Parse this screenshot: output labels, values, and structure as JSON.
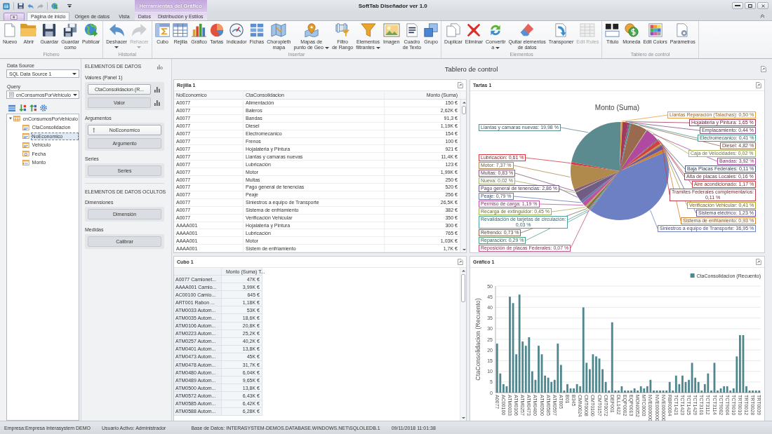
{
  "window": {
    "title": "SoftTab Diseñador ver 1.0",
    "context_header": "Herramientas del Gráfico"
  },
  "ribbon": {
    "tabs": [
      {
        "label": "Página de inicio",
        "selected": true,
        "contextual": false
      },
      {
        "label": "Origen de datos",
        "selected": false,
        "contextual": false
      },
      {
        "label": "Vista",
        "selected": false,
        "contextual": false
      },
      {
        "label": "Datos",
        "selected": false,
        "contextual": true
      },
      {
        "label": "Distribución y Estilos",
        "selected": false,
        "contextual": true
      }
    ],
    "groups": [
      {
        "label": "Fichero",
        "buttons": [
          {
            "label": "Nuevo",
            "disabled": false,
            "menu": false
          },
          {
            "label": "Abrir",
            "disabled": false,
            "menu": false
          },
          {
            "label": "Guardar",
            "disabled": false,
            "menu": false
          },
          {
            "label": "Guardar\ncomo",
            "disabled": false,
            "menu": false
          },
          {
            "label": "Publicar",
            "disabled": false,
            "menu": false
          }
        ]
      },
      {
        "label": "Historial",
        "buttons": [
          {
            "label": "Deshacer",
            "disabled": false,
            "menu": true
          },
          {
            "label": "Rehacer",
            "disabled": true,
            "menu": true
          }
        ]
      },
      {
        "label": "Insertar",
        "buttons": [
          {
            "label": "Cubo",
            "disabled": false,
            "menu": false
          },
          {
            "label": "Rejilla",
            "disabled": false,
            "menu": false
          },
          {
            "label": "Gráfico",
            "disabled": false,
            "menu": false
          },
          {
            "label": "Tartas",
            "disabled": false,
            "menu": false
          },
          {
            "label": "Indicador",
            "disabled": false,
            "menu": false
          },
          {
            "label": "Fichas",
            "disabled": false,
            "menu": false
          },
          {
            "label": "Choropleth\nmapa",
            "disabled": false,
            "menu": false
          },
          {
            "label": "Mapas de\npunto de Geo",
            "disabled": false,
            "menu": true
          },
          {
            "label": "Filtro\nde Rango",
            "disabled": false,
            "menu": false
          },
          {
            "label": "Elementos\nfiltrantes",
            "disabled": false,
            "menu": true
          },
          {
            "label": "Imagen",
            "disabled": false,
            "menu": false
          },
          {
            "label": "Cuadro\nde Texto",
            "disabled": false,
            "menu": false
          },
          {
            "label": "Grupo",
            "disabled": false,
            "menu": false
          }
        ]
      },
      {
        "label": "Elementos",
        "buttons": [
          {
            "label": "Duplicar",
            "disabled": false,
            "menu": false
          },
          {
            "label": "Eliminar",
            "disabled": false,
            "menu": false
          },
          {
            "label": "Convertir\na",
            "disabled": false,
            "menu": true
          },
          {
            "label": "Quitar elementos\nde datos",
            "disabled": false,
            "menu": false
          },
          {
            "label": "Transponer",
            "disabled": false,
            "menu": false
          },
          {
            "label": "Edit Rules",
            "disabled": true,
            "menu": false
          }
        ]
      },
      {
        "label": "Tablero de control",
        "buttons": [
          {
            "label": "Título",
            "disabled": false,
            "menu": false
          },
          {
            "label": "Moneda",
            "disabled": false,
            "menu": false
          },
          {
            "label": "Edit Colors",
            "disabled": false,
            "menu": false
          },
          {
            "label": "Parámetros",
            "disabled": false,
            "menu": false
          }
        ]
      }
    ]
  },
  "data_source": {
    "label": "Data Source",
    "value": "SQL Data Source 1"
  },
  "query": {
    "label": "Query",
    "value": "cnConsumosPorVehiculo"
  },
  "field_tree": [
    {
      "label": "cnConsumosPorVehiculo",
      "expanded": true,
      "selected": false,
      "children": [
        {
          "label": "CtaConsolidacion",
          "selected": false,
          "kind": "text"
        },
        {
          "label": "NoEconomico",
          "selected": true,
          "kind": "text"
        },
        {
          "label": "Vehiculo",
          "selected": false,
          "kind": "text"
        },
        {
          "label": "Fecha",
          "selected": false,
          "kind": "date"
        },
        {
          "label": "Monto",
          "selected": false,
          "kind": "number"
        }
      ]
    }
  ],
  "data_items": {
    "title": "ELEMENTOS DE DATOS",
    "sections": [
      {
        "label": "Valores (Panel 1)",
        "slots": [
          {
            "text": "CtaConsolidacion (R...",
            "filled": true,
            "kind": "value"
          },
          {
            "text": "Valor",
            "filled": false,
            "kind": "value"
          }
        ]
      },
      {
        "label": "Argumentos",
        "slots": [
          {
            "text": "NoEconomico",
            "filled": true,
            "kind": "field"
          },
          {
            "text": "Argumento",
            "filled": false,
            "kind": "field"
          }
        ]
      },
      {
        "label": "Series",
        "slots": [
          {
            "text": "Series",
            "filled": false,
            "kind": "field"
          }
        ]
      }
    ],
    "hidden_title": "ELEMENTOS DE DATOS OCULTOS",
    "hidden_sections": [
      {
        "label": "Dimensiones",
        "slots": [
          {
            "text": "Dimensión",
            "filled": false,
            "kind": "field"
          }
        ]
      },
      {
        "label": "Medidas",
        "slots": [
          {
            "text": "Calibrar",
            "filled": false,
            "kind": "field"
          }
        ]
      }
    ]
  },
  "dashboard": {
    "title": "Tablero de control",
    "grid": {
      "title": "Rejilla 1",
      "columns": [
        "NoEconomico",
        "CtaConsolidacion",
        "Monto (Suma)"
      ],
      "rows": [
        [
          "A0077",
          "Alimentación",
          "150 €"
        ],
        [
          "A0077",
          "Baleros",
          "2,62K €"
        ],
        [
          "A0077",
          "Bandas",
          "91,3 €"
        ],
        [
          "A0077",
          "Diesel",
          "1,19K €"
        ],
        [
          "A0077",
          "Electromecanico",
          "154 €"
        ],
        [
          "A0077",
          "Frenos",
          "100 €"
        ],
        [
          "A0077",
          "Hojalateria y Pintura",
          "921 €"
        ],
        [
          "A0077",
          "Llantas y camaras nuevas",
          "11,4K €"
        ],
        [
          "A0077",
          "Lubricación",
          "123 €"
        ],
        [
          "A0077",
          "Motor",
          "1,99K €"
        ],
        [
          "A0077",
          "Multas",
          "250 €"
        ],
        [
          "A0077",
          "Pago general de tenencias",
          "520 €"
        ],
        [
          "A0077",
          "Peaje",
          "256 €"
        ],
        [
          "A0077",
          "Siniestros a equipo de Transporte",
          "26,5K €"
        ],
        [
          "A0077",
          "Sistema de enfriamiento",
          "382 €"
        ],
        [
          "A0077",
          "Verificación Vehicular",
          "350 €"
        ],
        [
          "AAAA001",
          "Hojalateria y Pintura",
          "300 €"
        ],
        [
          "AAAA001",
          "Lubricación",
          "765 €"
        ],
        [
          "AAAA001",
          "Motor",
          "1,03K €"
        ],
        [
          "AAAA001",
          "Sistem de enfriamiento",
          "1,7K €"
        ]
      ]
    },
    "pie": {
      "title": "Tartas 1",
      "chart_data": {
        "type": "pie",
        "title": "Monto (Suma)",
        "categories": [
          "Lubricación: 0,61 %",
          "Llantas y camaras nuevas: 19,98 %",
          "Llantas Reparación (Talachas): 0,50 %",
          "Hojalateria y Pintura: 1,65 %",
          "Emplacamiento: 0,44 %",
          "Electromecanico: 0,41 %",
          "Diesel: 4,82 %",
          "Caja de Velocidades: 0,02 %",
          "Bandas: 3,92 %",
          "Baja Placas Federales: 0,11 %",
          "Alta de placas Locales: 0,16 %",
          "Aire acondicionado: 1,17 %",
          "Verificación Vehicular: 0,41 %",
          "Tramites Federales complementarios:\n0,11 %",
          "Sistema eléctrico: 1,23 %",
          "Sistema de enfriamiento: 0,93 %",
          "Siniestros a equipo de Transporte: 36,95 %",
          "Revalidación de tarjetas de circulación:\n0,03 %",
          "Reposición de placas Federales: 0,07 %",
          "Reparación: 0,29 %",
          "Refrendo: 0,73 %",
          "Recarga de extinguidor: 0,45 %",
          "Permiso de carga: 1,19 %",
          "Peaje: 0,79 %",
          "Pago general de tenencias: 2,86 %",
          "Nueva: 0,02 %",
          "Multas: 0,83 %",
          "Motor: 7,37 %"
        ],
        "values": [
          0.61,
          19.98,
          0.5,
          1.65,
          0.44,
          0.41,
          4.82,
          0.02,
          3.92,
          0.11,
          0.16,
          1.17,
          0.41,
          0.11,
          1.23,
          0.93,
          36.95,
          0.03,
          0.07,
          0.29,
          0.73,
          0.45,
          1.19,
          0.79,
          2.86,
          0.02,
          0.83,
          7.37
        ]
      }
    },
    "pivot": {
      "title": "Cubo 1",
      "columns": [
        "",
        "Monto (Suma) T..."
      ],
      "rows": [
        [
          "A0077 Camionet...",
          "47K €"
        ],
        [
          "AAAA001 Camio...",
          "3,99K €"
        ],
        [
          "AC00100 Camio...",
          "645 €"
        ],
        [
          "ART001 Rabon ...",
          "1,18K €"
        ],
        [
          "ATM0033 Autom...",
          "53K €"
        ],
        [
          "ATM0035 Autom...",
          "18,6K €"
        ],
        [
          "ATM0106 Autom...",
          "20,8K €"
        ],
        [
          "ATM0223 Autom...",
          "25,2K €"
        ],
        [
          "ATM0257 Autom...",
          "40,2K €"
        ],
        [
          "ATM0401 Autom...",
          "13,8K €"
        ],
        [
          "ATM0473 Autom...",
          "45K €"
        ],
        [
          "ATM0478 Autom...",
          "31,7K €"
        ],
        [
          "ATM0480 Autom...",
          "6,04K €"
        ],
        [
          "ATM0489 Autom...",
          "9,65K €"
        ],
        [
          "ATM0500 Autom...",
          "13,8K €"
        ],
        [
          "ATM0572 Autom...",
          "6,43K €"
        ],
        [
          "ATM0585 Autom...",
          "6,42K €"
        ],
        [
          "ATM0588 Autom...",
          "6,28K €"
        ]
      ]
    },
    "bar": {
      "title": "Gráfico 1",
      "chart_data": {
        "type": "bar",
        "ylabel": "CtaConsolidacion (Recuento)",
        "grid": true,
        "categories": [
          "A0077",
          null,
          "AC00100",
          null,
          "ATM0033",
          null,
          "ATM0106",
          null,
          "ATM0257",
          null,
          "ATM0473",
          null,
          "ATM0480",
          null,
          "ATM0500",
          null,
          "ATM0585",
          null,
          "ATM0597",
          null,
          "AT005",
          null,
          "B01",
          null,
          "B345",
          null,
          "CMN0024",
          null,
          "CMT0008",
          null,
          "CMT0100",
          null,
          "CMT0157",
          null,
          "CMT0072",
          null,
          "DEF001",
          null,
          "DLL1422",
          null,
          "EQP0002",
          null,
          "EQP0013",
          null,
          "MON0052",
          null,
          "MTC0003",
          null,
          "NVE000000",
          null,
          "NVE000000",
          null,
          "NVE000000",
          null,
          "RBR0004",
          null,
          "TCT1421",
          null,
          "TCT1423",
          null,
          "TCT1425",
          null,
          "TCT1429",
          null,
          "TCT3101",
          null,
          "TCT3112",
          null,
          "TCT3114",
          null,
          "TCT9002",
          null,
          "TCT9004",
          null,
          "TCT9010",
          null,
          "TRT0010",
          null,
          "TRT0012",
          null,
          "TRT0028",
          null,
          "TRT0039"
        ],
        "series": [
          {
            "name": "CtaConsolidacion (Recuento)",
            "color": "#4f878e",
            "values": [
              23,
              9,
              4,
              3,
              45,
              42,
              18,
              46,
              24,
              22,
              26,
              10,
              6,
              22,
              18,
              8,
              7,
              5,
              6,
              23,
              13,
              1,
              4,
              2,
              2,
              4,
              3,
              40,
              14,
              11,
              18,
              17,
              16,
              11,
              5,
              1,
              33,
              1,
              1,
              3,
              1,
              1,
              1,
              2,
              1,
              3,
              2,
              3,
              6,
              1,
              1,
              1,
              1,
              1,
              5,
              1,
              8,
              4,
              8,
              5,
              6,
              14,
              7,
              5,
              1,
              4,
              9,
              1,
              14,
              1,
              2,
              3,
              3,
              1,
              2,
              17,
              27,
              27,
              3,
              1,
              1,
              1,
              1
            ]
          }
        ],
        "ylim": [
          0,
          50
        ],
        "yticks": [
          0,
          5,
          10,
          15,
          20,
          25,
          30,
          35,
          40,
          45,
          50
        ]
      }
    }
  },
  "status_bar": [
    "Empresa:Empresa Interasystem DEMO",
    "Usuario Activo: Administrador",
    "Base de Datos: INTERASYSTEM-DEMOS.DATABASE.WINDOWS.NET\\SQLOLEDB.1",
    "09/11/2018 11:01:38"
  ]
}
